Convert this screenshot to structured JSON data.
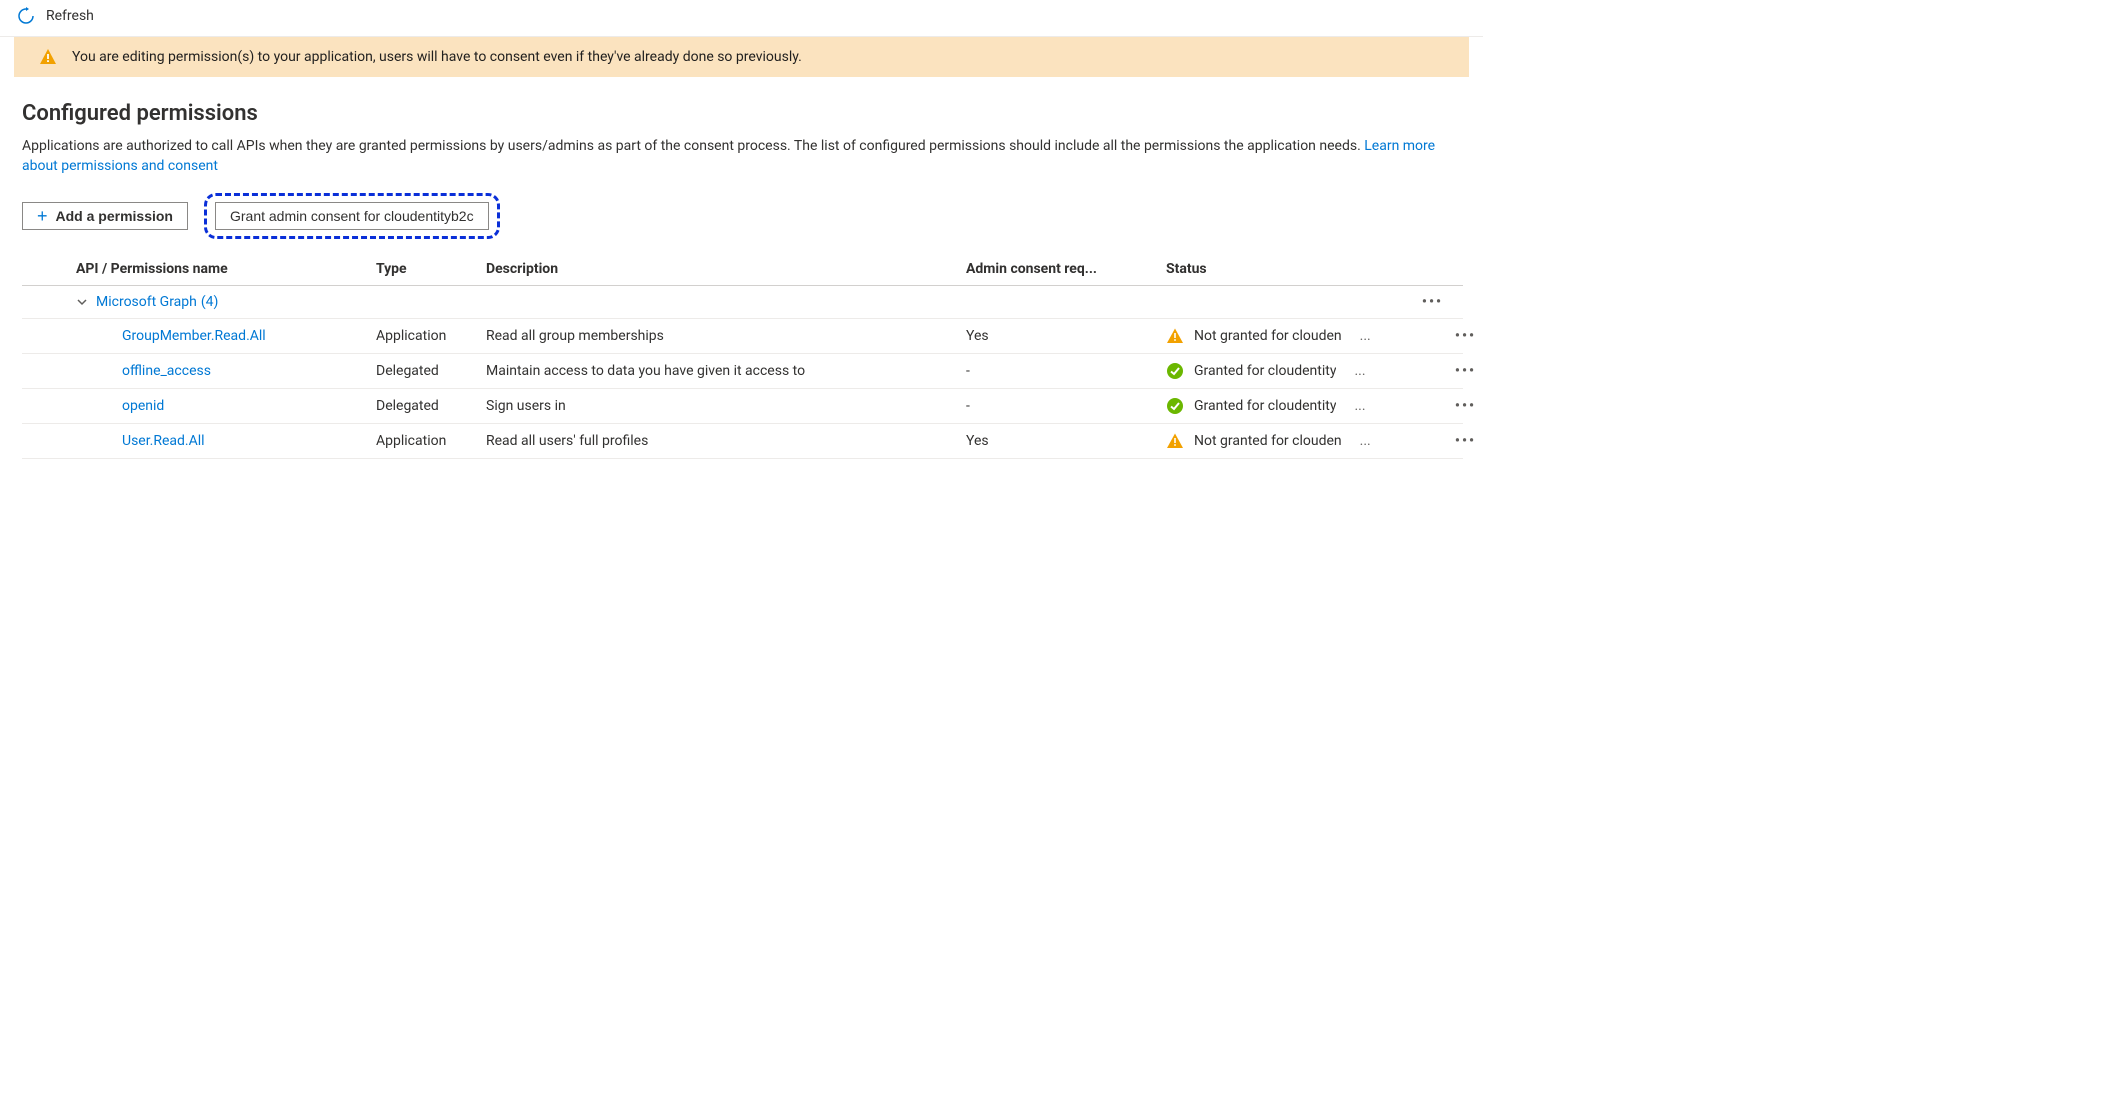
{
  "toolbar": {
    "refresh_label": "Refresh"
  },
  "notification": {
    "message": "You are editing permission(s) to your application, users will have to consent even if they've already done so previously."
  },
  "section": {
    "title": "Configured permissions",
    "description_part1": "Applications are authorized to call APIs when they are granted permissions by users/admins as part of the consent process. The list of configured permissions should include all the permissions the application needs. ",
    "learn_more_label": "Learn more about permissions and consent"
  },
  "actions": {
    "add_permission_label": "Add a permission",
    "grant_consent_label": "Grant admin consent for cloudentityb2c"
  },
  "table": {
    "headers": {
      "api": "API / Permissions name",
      "type": "Type",
      "description": "Description",
      "admin": "Admin consent req...",
      "status": "Status"
    },
    "group": {
      "name": "Microsoft Graph",
      "count": "(4)"
    },
    "rows": [
      {
        "name": "GroupMember.Read.All",
        "type": "Application",
        "description": "Read all group memberships",
        "admin": "Yes",
        "status_icon": "warn",
        "status": "Not granted for clouden"
      },
      {
        "name": "offline_access",
        "type": "Delegated",
        "description": "Maintain access to data you have given it access to",
        "admin": "-",
        "status_icon": "ok",
        "status": "Granted for cloudentity"
      },
      {
        "name": "openid",
        "type": "Delegated",
        "description": "Sign users in",
        "admin": "-",
        "status_icon": "ok",
        "status": "Granted for cloudentity"
      },
      {
        "name": "User.Read.All",
        "type": "Application",
        "description": "Read all users' full profiles",
        "admin": "Yes",
        "status_icon": "warn",
        "status": "Not granted for clouden"
      }
    ]
  }
}
